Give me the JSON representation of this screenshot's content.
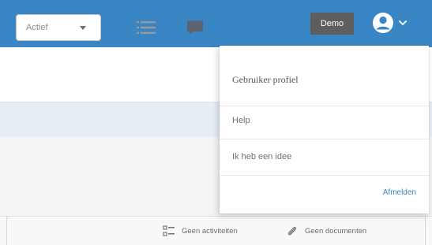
{
  "header": {
    "env_badge": "Demo",
    "colors": {
      "header_bg": "#3a86c4",
      "badge_bg": "#5e5e5e",
      "link": "#3a86c4"
    },
    "icons": {
      "user": "user-circle-icon",
      "chevron": "chevron-down-icon"
    }
  },
  "toolbar": {
    "status_select": {
      "value": "Actief"
    },
    "icons": {
      "list_view": "list-view-icon",
      "chat": "chat-icon"
    }
  },
  "user_menu": {
    "items": [
      {
        "label": "Gebruiker profiel"
      },
      {
        "label": "Help"
      },
      {
        "label": "Ik heb een idee"
      }
    ],
    "logout_label": "Afmelden"
  },
  "footer": {
    "no_activities_label": "Geen activiteiten",
    "no_documents_label": "Geen documenten",
    "icons": {
      "activities": "checklist-icon",
      "documents": "paperclip-icon"
    }
  }
}
